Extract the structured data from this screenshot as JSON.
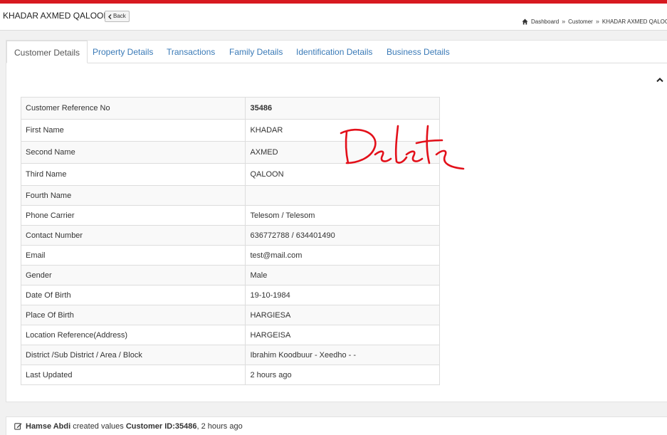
{
  "header": {
    "title": "KHADAR AXMED QALOON",
    "back_label": "Back",
    "breadcrumb": [
      "Dashboard",
      "Customer",
      "KHADAR AXMED QALOON"
    ]
  },
  "tabs": [
    {
      "label": "Customer Details",
      "active": true
    },
    {
      "label": "Property Details",
      "active": false
    },
    {
      "label": "Transactions",
      "active": false
    },
    {
      "label": "Family Details",
      "active": false
    },
    {
      "label": "Identification Details",
      "active": false
    },
    {
      "label": "Business Details",
      "active": false
    }
  ],
  "details": [
    {
      "label": "Customer Reference No",
      "value": "35486"
    },
    {
      "label": "First Name",
      "value": "KHADAR"
    },
    {
      "label": "Second Name",
      "value": "AXMED"
    },
    {
      "label": "Third Name",
      "value": "QALOON"
    },
    {
      "label": "Fourth Name",
      "value": ""
    },
    {
      "label": "Phone Carrier",
      "value": "Telesom / Telesom"
    },
    {
      "label": "Contact Number",
      "value": "636772788 / 634401490"
    },
    {
      "label": "Email",
      "value": "test@mail.com"
    },
    {
      "label": "Gender",
      "value": "Male"
    },
    {
      "label": "Date Of Birth",
      "value": "19-10-1984"
    },
    {
      "label": "Place Of Birth",
      "value": "HARGIESA"
    },
    {
      "label": "Location Reference(Address)",
      "value": "HARGEISA"
    },
    {
      "label": "District /Sub District / Area / Block",
      "value": "Ibrahim Koodbuur - Xeedho - -"
    },
    {
      "label": "Last Updated",
      "value": "2 hours ago"
    }
  ],
  "annotation": {
    "text": "Delete",
    "color": "#e3101a"
  },
  "activity": {
    "user": "Hamse Abdi",
    "action": "created values",
    "target": "Customer ID:35486",
    "time": ", 2 hours ago"
  },
  "colors": {
    "accent_red": "#d71920",
    "link_blue": "#3a7ab7"
  }
}
